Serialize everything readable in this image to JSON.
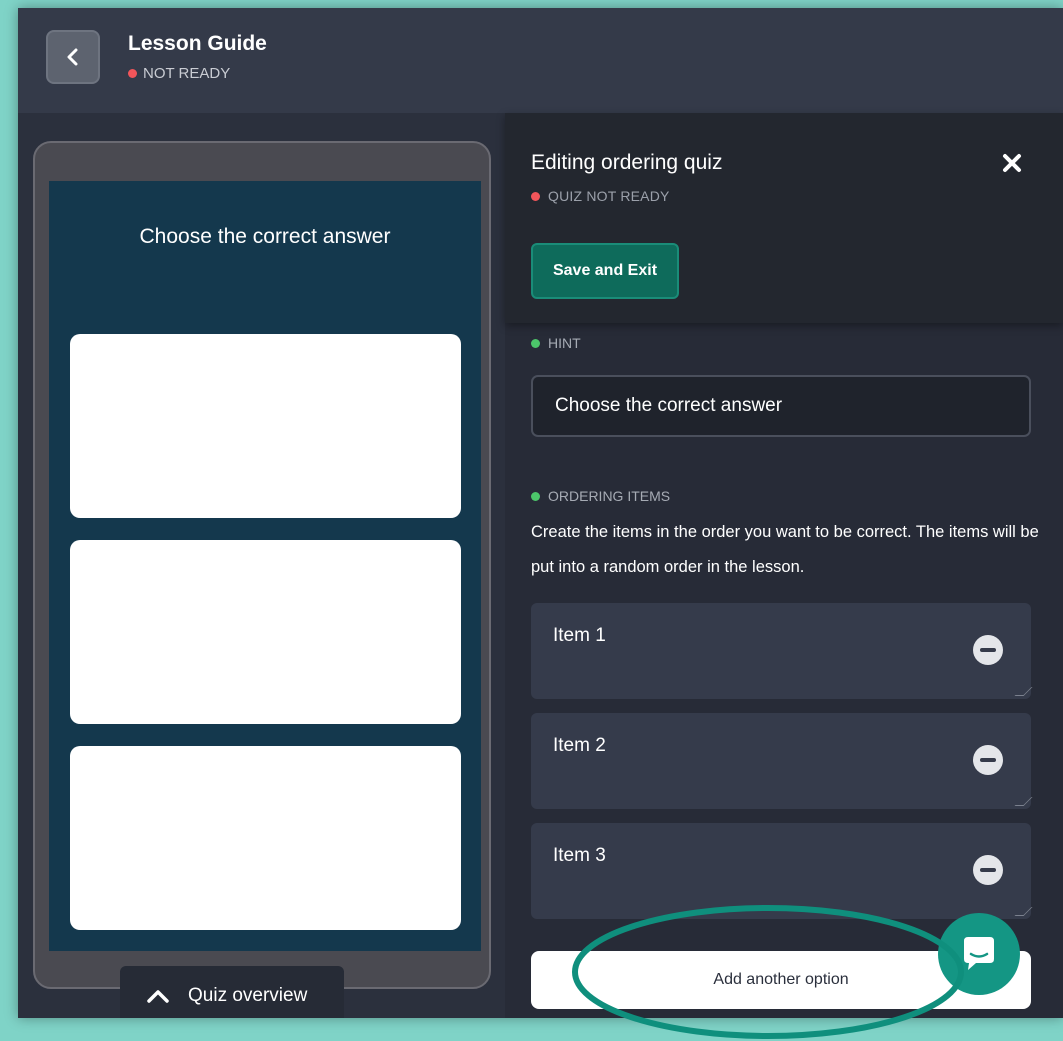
{
  "header": {
    "title": "Lesson Guide",
    "status": "NOT READY"
  },
  "preview": {
    "hint": "Choose the correct answer",
    "quiz_overview_label": "Quiz overview"
  },
  "editor": {
    "title": "Editing ordering quiz",
    "status": "QUIZ NOT READY",
    "save_label": "Save and Exit",
    "hint_section_label": "HINT",
    "hint_value": "Choose the correct answer",
    "ordering_section_label": "ORDERING ITEMS",
    "description": "Create the items in the order you want to be correct. The items will be put into a random order in the lesson.",
    "items": [
      {
        "label": "Item 1"
      },
      {
        "label": "Item 2"
      },
      {
        "label": "Item 3"
      }
    ],
    "add_option_label": "Add another option"
  },
  "colors": {
    "accent": "#0e6b5b",
    "not_ready": "#f2555a",
    "ready": "#4cc56a",
    "annotation": "#0f8f7d"
  },
  "icons": {
    "back": "chevron-left-icon",
    "close": "close-icon",
    "quiz_overview": "chevron-up-icon",
    "remove_item": "minus-circle-icon",
    "chat": "chat-icon"
  }
}
